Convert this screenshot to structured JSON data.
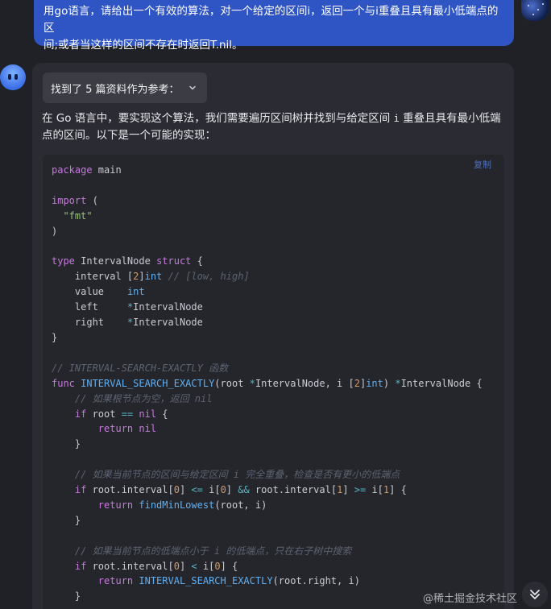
{
  "user_message": {
    "line1": "用go语言，请给出一个有效的算法，对一个给定的区间i，返回一个与i重叠且具有最小低端点的区",
    "line2": "间;或者当这样的区间不存在时返回T.nil。"
  },
  "answer": {
    "refs_label": "找到了 5 篇资料作为参考：",
    "intro_part1": "在 Go 语言中，要实现这个算法，我们需要遍历区间树并找到与给定区间 ",
    "intro_code": "i",
    "intro_part2": " 重叠且具有最小低端点的区间。以下是一个可能的实现：",
    "copy_label": "复制"
  },
  "code": {
    "l1_kw": "package",
    "l1_rest": " main",
    "l3_kw": "import",
    "l3_rest": " (",
    "l4": "\"fmt\"",
    "l5": ")",
    "l7_kw": "type",
    "l7_name": " IntervalNode ",
    "l7_kw2": "struct",
    "l7_rest": " {",
    "l8_a": "interval [",
    "l8_num": "2",
    "l8_b": "]",
    "l8_ty": "int",
    "l8_cm": " // [low, high]",
    "l9_a": "value    ",
    "l9_ty": "int",
    "l10_a": "left     ",
    "l10_op": "*",
    "l10_b": "IntervalNode",
    "l11_a": "right    ",
    "l11_op": "*",
    "l11_b": "IntervalNode",
    "l12": "}",
    "l14_cm": "// INTERVAL-SEARCH-EXACTLY 函数",
    "l15_kw": "func",
    "l15_fn": " INTERVAL_SEARCH_EXACTLY",
    "l15_a": "(root ",
    "l15_op": "*",
    "l15_b": "IntervalNode, i [",
    "l15_num": "2",
    "l15_c": "]",
    "l15_ty": "int",
    "l15_d": ") ",
    "l15_op2": "*",
    "l15_e": "IntervalNode {",
    "l16_cm": "// 如果根节点为空，返回 nil",
    "l17_kw": "if",
    "l17_a": " root ",
    "l17_op": "==",
    "l17_kw2": " nil",
    "l17_b": " {",
    "l18_kw": "return",
    "l18_kw2": " nil",
    "l19": "}",
    "l21_cm": "// 如果当前节点的区间与给定区间 i 完全重叠，检查是否有更小的低端点",
    "l22_kw": "if",
    "l22_a": " root.interval[",
    "l22_n1": "0",
    "l22_b": "] ",
    "l22_op1": "<=",
    "l22_c": " i[",
    "l22_n2": "0",
    "l22_d": "] ",
    "l22_op2": "&&",
    "l22_e": " root.interval[",
    "l22_n3": "1",
    "l22_f": "] ",
    "l22_op3": ">=",
    "l22_g": " i[",
    "l22_n4": "1",
    "l22_h": "] {",
    "l23_kw": "return",
    "l23_fn": " findMinLowest",
    "l23_a": "(root, i)",
    "l24": "}",
    "l26_cm": "// 如果当前节点的低端点小于 i 的低端点，只在右子树中搜索",
    "l27_kw": "if",
    "l27_a": " root.interval[",
    "l27_n1": "0",
    "l27_b": "] ",
    "l27_op": "<",
    "l27_c": " i[",
    "l27_n2": "0",
    "l27_d": "] {",
    "l28_kw": "return",
    "l28_fn": " INTERVAL_SEARCH_EXACTLY",
    "l28_a": "(root.right, i)",
    "l29": "}"
  },
  "watermark": "@稀土掘金技术社区",
  "icons": {
    "refs_chevron": "chevron-down-icon",
    "scroll_down": "double-chevron-down-icon"
  },
  "colors": {
    "user_bubble": "#2f55c4",
    "keyword": "#c678dd",
    "type": "#61afef",
    "string": "#98c379",
    "comment": "#5c6370"
  }
}
